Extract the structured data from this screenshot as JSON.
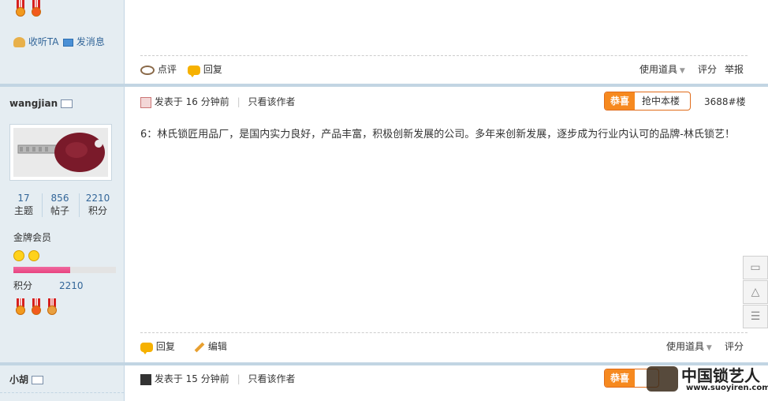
{
  "post1": {
    "follow_label": "收听TA",
    "message_label": "发消息",
    "rate_label": "点评",
    "reply_label": "回复",
    "tools_label": "使用道具",
    "score_label": "评分",
    "report_label": "举报"
  },
  "post2": {
    "username": "wangjian",
    "stats": [
      {
        "value": "17",
        "label": "主题"
      },
      {
        "value": "856",
        "label": "帖子"
      },
      {
        "value": "2210",
        "label": "积分"
      }
    ],
    "rank": "金牌会员",
    "progress_fraction": 0.55,
    "points_label": "积分",
    "points_value": "2210",
    "posted_time": "发表于 16 分钟前",
    "only_author": "只看该作者",
    "congrats_label": "恭喜",
    "grab_floor_label": "抢中本楼",
    "floor_label": "3688#楼",
    "content": "6：林氏锁匠用品厂，是国内实力良好，产品丰富，积极创新发展的公司。多年来创新发展，逐步成为行业内认可的品牌-林氏锁艺！",
    "reply_label": "回复",
    "edit_label": "编辑",
    "tools_label": "使用道具",
    "score_label": "评分"
  },
  "post3": {
    "username": "小胡",
    "posted_time": "发表于 15 分钟前",
    "only_author": "只看该作者",
    "congrats_label": "恭喜"
  },
  "watermark": {
    "brand": "中国锁艺人",
    "url": "www.suoyiren.com"
  },
  "icons": [
    "follow-icon",
    "mail-icon",
    "rate-icon",
    "reply-icon",
    "edit-icon",
    "vcard-icon",
    "smile-icon",
    "moon-icon",
    "comment-icon",
    "top-icon",
    "list-icon"
  ],
  "colors": {
    "accent_orange": "#f6891f",
    "link_blue": "#336699",
    "sidebar": "#e5edf2",
    "progress": "#e8437f"
  }
}
